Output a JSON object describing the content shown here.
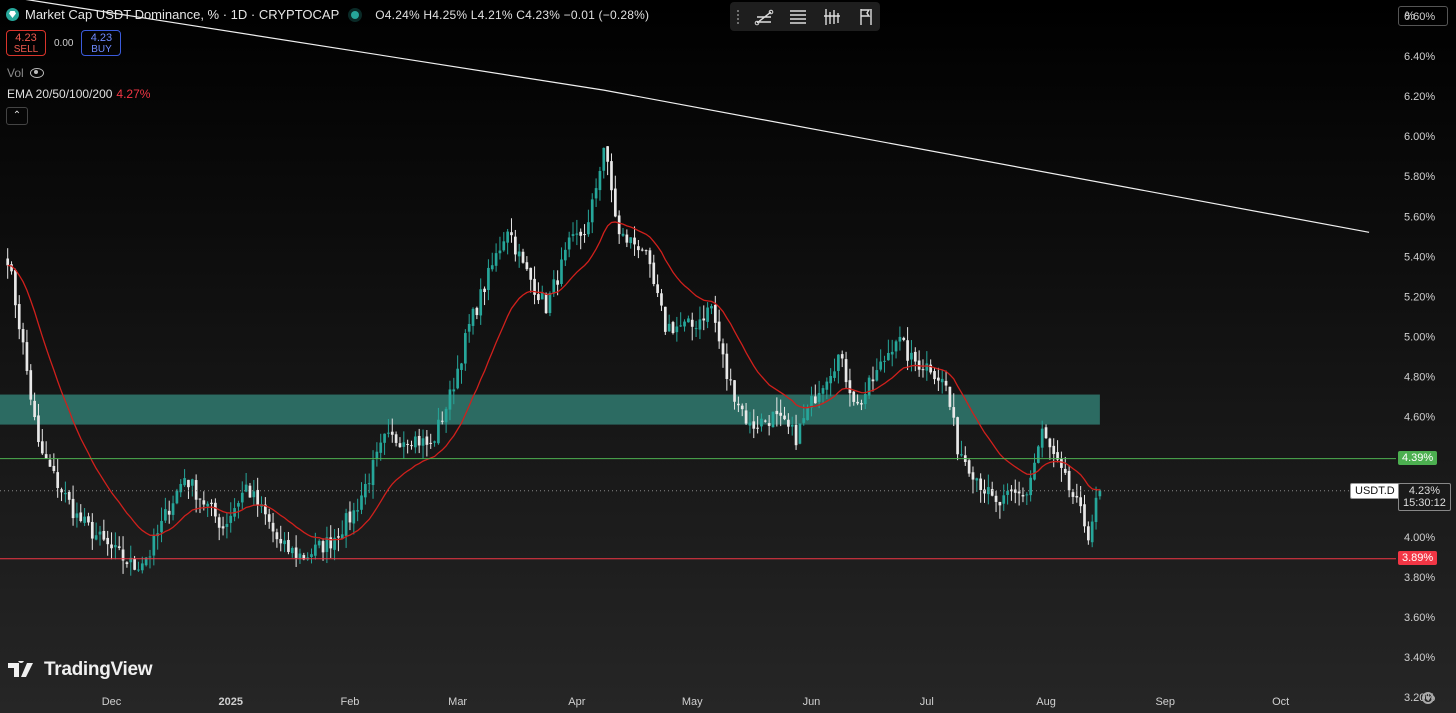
{
  "header": {
    "title": "Market Cap USDT Dominance, % · 1D · CRYPTOCAP",
    "ohlc": "O4.24% H4.25% L4.21% C4.23% −0.01 (−0.28%)"
  },
  "trade": {
    "sell_price": "4.23",
    "sell_label": "SELL",
    "spread": "0.00",
    "buy_price": "4.23",
    "buy_label": "BUY"
  },
  "indicators": {
    "vol_label": "Vol",
    "ema_label": "EMA 20/50/100/200",
    "ema_value": "4.27%"
  },
  "scale_mode": "%",
  "brand": "TradingView",
  "colors": {
    "up": "#26a69a",
    "down": "#e8e8e8",
    "ema": "#d0201c",
    "zone": "#2c6b62",
    "support": "#f23645",
    "resistance": "#4caf50",
    "background": "#0b0b0b"
  },
  "chart_data": {
    "type": "candlestick",
    "title": "Market Cap USDT Dominance, % · 1D · CRYPTOCAP",
    "ylim": [
      3.12,
      6.68
    ],
    "y_ticks": [
      "6.60%",
      "6.40%",
      "6.20%",
      "6.00%",
      "5.80%",
      "5.60%",
      "5.40%",
      "5.20%",
      "5.00%",
      "4.80%",
      "4.60%",
      "4.40%",
      "4.20%",
      "4.00%",
      "3.80%",
      "3.60%",
      "3.40%",
      "3.20%"
    ],
    "x_ticks": [
      "Dec",
      "2025",
      "Feb",
      "Mar",
      "Apr",
      "May",
      "Jun",
      "Jul",
      "Aug",
      "Sep",
      "Oct"
    ],
    "x_tick_dates": [
      "2024-12-01",
      "2025-01-01",
      "2025-02-01",
      "2025-03-01",
      "2025-04-01",
      "2025-05-01",
      "2025-06-01",
      "2025-07-01",
      "2025-08-01",
      "2025-09-01",
      "2025-10-01"
    ],
    "x_range": [
      "2024-11-02",
      "2025-10-31"
    ],
    "symbol_tag": "USDT.D",
    "last_price": "4.23%",
    "countdown": "15:30:12",
    "last_value": 4.23,
    "resistance_label": "4.39%",
    "resistance_value": 4.39,
    "support_label": "3.89%",
    "support_value": 3.89,
    "zone": {
      "low": 4.56,
      "high": 4.71,
      "x_end": "2025-08-15"
    },
    "trendline": [
      [
        "2024-11-03",
        6.7
      ],
      [
        "2025-04-08",
        6.23
      ],
      [
        "2025-10-24",
        5.52
      ]
    ],
    "keypoints": [
      [
        "2024-11-04",
        5.4
      ],
      [
        "2024-11-08",
        4.95
      ],
      [
        "2024-11-12",
        4.45
      ],
      [
        "2024-11-16",
        4.3
      ],
      [
        "2024-11-22",
        4.1
      ],
      [
        "2024-11-30",
        3.95
      ],
      [
        "2024-12-07",
        3.85
      ],
      [
        "2024-12-11",
        3.92
      ],
      [
        "2024-12-16",
        4.15
      ],
      [
        "2024-12-20",
        4.3
      ],
      [
        "2024-12-24",
        4.2
      ],
      [
        "2024-12-30",
        4.05
      ],
      [
        "2025-01-05",
        4.25
      ],
      [
        "2025-01-10",
        4.1
      ],
      [
        "2025-01-14",
        3.95
      ],
      [
        "2025-01-20",
        3.9
      ],
      [
        "2025-01-27",
        3.98
      ],
      [
        "2025-02-02",
        4.12
      ],
      [
        "2025-02-06",
        4.3
      ],
      [
        "2025-02-10",
        4.48
      ],
      [
        "2025-02-17",
        4.5
      ],
      [
        "2025-02-22",
        4.45
      ],
      [
        "2025-02-27",
        4.7
      ],
      [
        "2025-03-04",
        5.05
      ],
      [
        "2025-03-09",
        5.3
      ],
      [
        "2025-03-14",
        5.55
      ],
      [
        "2025-03-18",
        5.35
      ],
      [
        "2025-03-24",
        5.15
      ],
      [
        "2025-03-30",
        5.45
      ],
      [
        "2025-04-04",
        5.55
      ],
      [
        "2025-04-08",
        5.95
      ],
      [
        "2025-04-12",
        5.5
      ],
      [
        "2025-04-18",
        5.45
      ],
      [
        "2025-04-24",
        5.05
      ],
      [
        "2025-05-01",
        5.05
      ],
      [
        "2025-05-06",
        5.15
      ],
      [
        "2025-05-10",
        4.8
      ],
      [
        "2025-05-16",
        4.55
      ],
      [
        "2025-05-22",
        4.6
      ],
      [
        "2025-05-28",
        4.5
      ],
      [
        "2025-06-03",
        4.75
      ],
      [
        "2025-06-08",
        4.9
      ],
      [
        "2025-06-13",
        4.65
      ],
      [
        "2025-06-19",
        4.85
      ],
      [
        "2025-06-23",
        5.0
      ],
      [
        "2025-06-27",
        4.88
      ],
      [
        "2025-07-02",
        4.85
      ],
      [
        "2025-07-06",
        4.75
      ],
      [
        "2025-07-09",
        4.45
      ],
      [
        "2025-07-14",
        4.3
      ],
      [
        "2025-07-19",
        4.15
      ],
      [
        "2025-07-23",
        4.2
      ],
      [
        "2025-07-27",
        4.22
      ],
      [
        "2025-07-31",
        4.52
      ],
      [
        "2025-08-04",
        4.35
      ],
      [
        "2025-08-08",
        4.2
      ],
      [
        "2025-08-12",
        4.02
      ],
      [
        "2025-08-15",
        4.23
      ]
    ]
  }
}
